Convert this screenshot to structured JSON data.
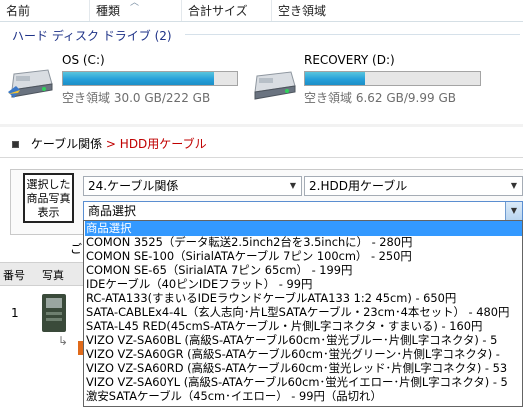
{
  "columns": [
    "名前",
    "種類",
    "合計サイズ",
    "空き領域"
  ],
  "group_title": "ハード ディスク ドライブ (2)",
  "drives": [
    {
      "name": "OS (C:)",
      "free_text": "空き領域 30.0 GB/222 GB",
      "used_fraction": 0.865
    },
    {
      "name": "RECOVERY (D:)",
      "free_text": "空き領域 6.62 GB/9.99 GB",
      "used_fraction": 0.34
    }
  ],
  "breadcrumb": {
    "parent": "ケーブル関係",
    "sep": " > ",
    "current": "HDD用ケーブル"
  },
  "show_button": "選択した\n商品写真\n表示",
  "selects": {
    "category": "24.ケーブル関係",
    "subcategory": "2.HDD用ケーブル",
    "product": "商品選択"
  },
  "partial_text": "ご",
  "table": {
    "col_number": "番号",
    "col_photo": "写真",
    "row_number": "1"
  },
  "dropdown_options": [
    "商品選択",
    "COMON 3525（データ転送2.5inch2台を3.5inchに） - 280円",
    "COMON SE-100（SirialATAケーブル 7ピン 100cm） - 250円",
    "COMON SE-65（SirialATA 7ピン 65cm） - 199円",
    "IDEケーブル（40ピンIDEフラット） - 99円",
    "RC-ATA133(すまいるIDEラウンドケーブルATA133 1:2 45cm) - 650円",
    "SATA-CABLEx4-4L（玄人志向･片L型SATAケーブル・23cm･4本セット） - 480円",
    "SATA-L45 RED(45cmS-ATAケーブル・片側L字コネクタ・すまいる) - 160円",
    "VIZO VZ-SA60BL (高級S-ATAケーブル60cm･蛍光ブルー･片側L字コネクタ) - 5",
    "VIZO VZ-SA60GR (高級S-ATAケーブル60cm･蛍光グリーン･片側L字コネクタ) -",
    "VIZO VZ-SA60RD (高級S-ATAケーブル60cm･蛍光レッド･片側L字コネクタ) - 53",
    "VIZO VZ-SA60YL (高級S-ATAケーブル60cm･蛍光イエロー･片側L字コネクタ) - 5",
    "激安SATAケーブル（45cm･イエロー） - 99円（品切れ）"
  ],
  "colors": {
    "accent": "#3399ff",
    "link_current": "#c00000",
    "group_title": "#1e3287",
    "bar_fill": "#26a0da"
  }
}
